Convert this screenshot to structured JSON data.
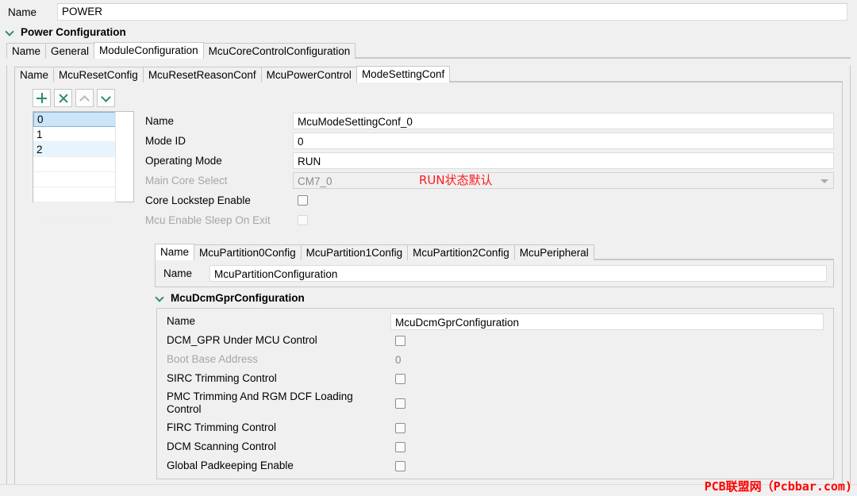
{
  "top": {
    "name_label": "Name",
    "name_value": "POWER"
  },
  "section": {
    "title": "Power Configuration",
    "chevron_icon": "chevron-down-icon"
  },
  "tabs_level1": [
    {
      "label": "Name",
      "active": false
    },
    {
      "label": "General",
      "active": false
    },
    {
      "label": "ModuleConfiguration",
      "active": true
    },
    {
      "label": "McuCoreControlConfiguration",
      "active": false
    }
  ],
  "tabs_level2": [
    {
      "label": "Name",
      "active": false
    },
    {
      "label": "McuResetConfig",
      "active": false
    },
    {
      "label": "McuResetReasonConf",
      "active": false
    },
    {
      "label": "McuPowerControl",
      "active": false
    },
    {
      "label": "ModeSettingConf",
      "active": true
    }
  ],
  "toolbar": {
    "add_icon": "plus-icon",
    "delete_icon": "close-x-icon",
    "move_up_icon": "chevron-up-icon",
    "move_down_icon": "chevron-down-icon"
  },
  "list": {
    "items": [
      {
        "label": "0",
        "selected": true
      },
      {
        "label": "1",
        "selected": false
      },
      {
        "label": "2",
        "selected": false
      }
    ]
  },
  "form": {
    "rows": [
      {
        "label": "Name",
        "value": "McuModeSettingConf_0",
        "type": "text",
        "disabled": false
      },
      {
        "label": "Mode ID",
        "value": "0",
        "type": "text",
        "disabled": false
      },
      {
        "label": "Operating Mode",
        "value": "RUN",
        "type": "text",
        "disabled": false
      },
      {
        "label": "Main Core Select",
        "value": "CM7_0",
        "type": "combo",
        "disabled": true
      },
      {
        "label": "Core Lockstep Enable",
        "value": "",
        "type": "checkbox",
        "disabled": false,
        "checked": false
      },
      {
        "label": "Mcu Enable Sleep On Exit",
        "value": "",
        "type": "checkbox",
        "disabled": true,
        "checked": false
      }
    ]
  },
  "tabs_level3": [
    {
      "label": "Name",
      "active": true
    },
    {
      "label": "McuPartition0Config",
      "active": false
    },
    {
      "label": "McuPartition1Config",
      "active": false
    },
    {
      "label": "McuPartition2Config",
      "active": false
    },
    {
      "label": "McuPeripheral",
      "active": false
    }
  ],
  "partition": {
    "name_label": "Name",
    "name_value": "McuPartitionConfiguration"
  },
  "dcm": {
    "title": "McuDcmGprConfiguration",
    "chevron_icon": "chevron-down-icon",
    "rows": [
      {
        "label": "Name",
        "value": "McuDcmGprConfiguration",
        "type": "text",
        "disabled": false
      },
      {
        "label": "DCM_GPR Under MCU Control",
        "value": "",
        "type": "checkbox",
        "disabled": false,
        "checked": false
      },
      {
        "label": "Boot Base Address",
        "value": "0",
        "type": "static",
        "disabled": true
      },
      {
        "label": "SIRC Trimming Control",
        "value": "",
        "type": "checkbox",
        "disabled": false,
        "checked": false
      },
      {
        "label": "PMC Trimming And RGM DCF Loading Control",
        "value": "",
        "type": "checkbox",
        "disabled": false,
        "checked": false
      },
      {
        "label": "FIRC Trimming Control",
        "value": "",
        "type": "checkbox",
        "disabled": false,
        "checked": false
      },
      {
        "label": "DCM Scanning Control",
        "value": "",
        "type": "checkbox",
        "disabled": false,
        "checked": false
      },
      {
        "label": "Global Padkeeping Enable",
        "value": "",
        "type": "checkbox",
        "disabled": false,
        "checked": false
      }
    ]
  },
  "annotations": {
    "operating_mode_note": "RUN状态默认",
    "watermark": "PCB联盟网（Pcbbar.com)"
  },
  "colors": {
    "accent_green": "#2e8b72",
    "selection_blue": "#cce4f7",
    "alt_row_blue": "#e8f4fd",
    "annotation_red": "#ff1a1a",
    "watermark_red": "#ff0000"
  }
}
